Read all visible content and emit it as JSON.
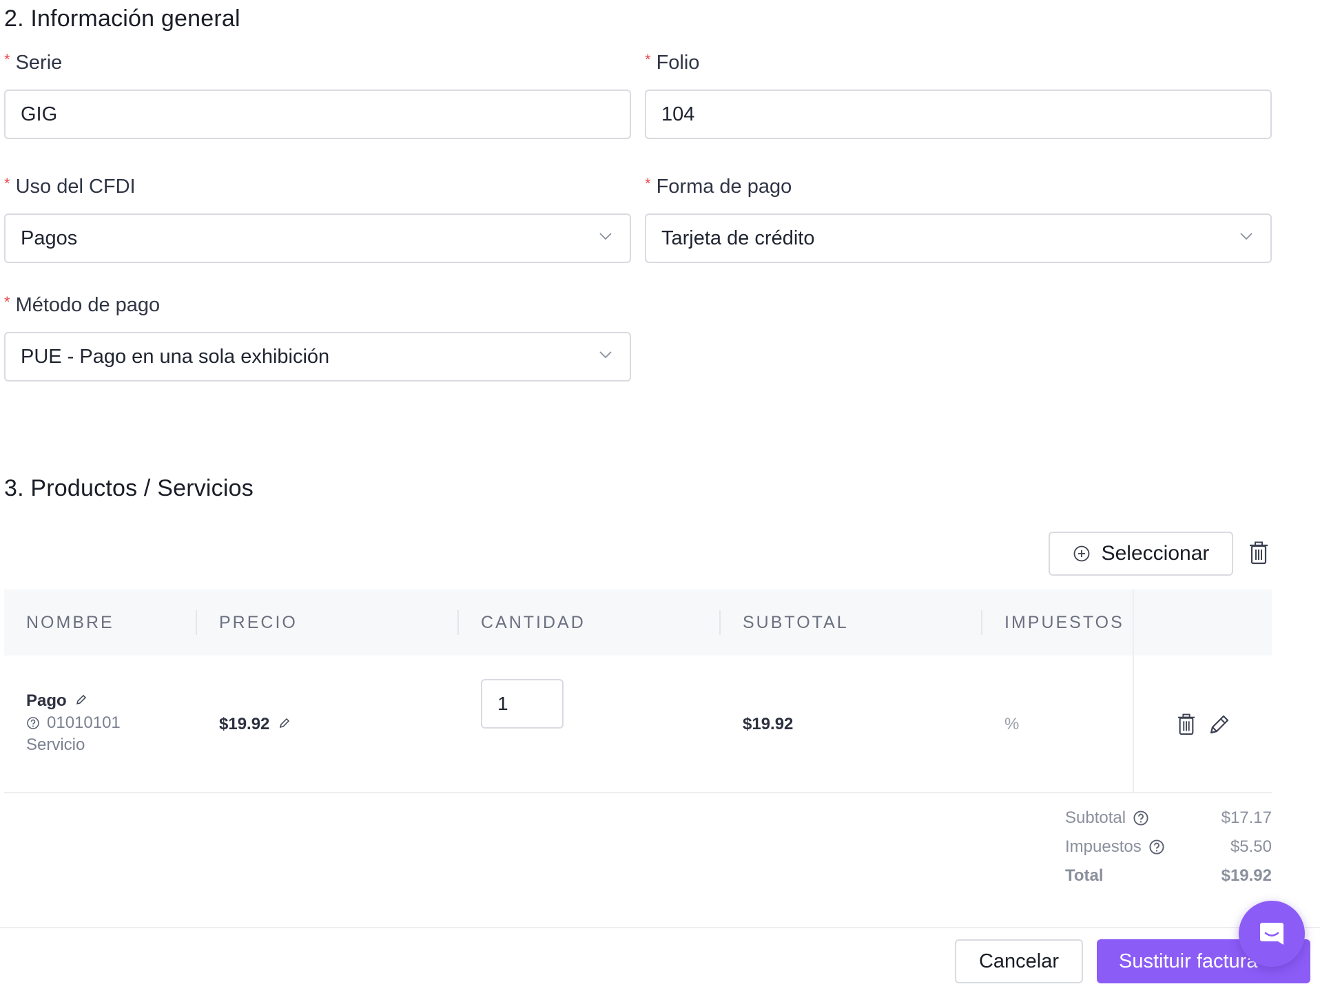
{
  "section2": {
    "title": "2. Información general",
    "fields": {
      "serie": {
        "label": "Serie",
        "value": "GIG"
      },
      "folio": {
        "label": "Folio",
        "value": "104"
      },
      "uso_cfdi": {
        "label": "Uso del CFDI",
        "value": "Pagos"
      },
      "forma_pago": {
        "label": "Forma de pago",
        "value": "Tarjeta de crédito"
      },
      "metodo_pago": {
        "label": "Método de pago",
        "value": "PUE - Pago en una sola exhibición"
      }
    },
    "required_marker": "*"
  },
  "section3": {
    "title": "3. Productos / Servicios",
    "select_button": "Seleccionar",
    "table": {
      "headers": [
        "NOMBRE",
        "PRECIO",
        "CANTIDAD",
        "SUBTOTAL",
        "IMPUESTOS"
      ],
      "rows": [
        {
          "name": "Pago",
          "code": "01010101",
          "type": "Servicio",
          "price": "$19.92",
          "quantity": "1",
          "subtotal": "$19.92",
          "taxes": "%"
        }
      ]
    },
    "summary": {
      "subtotal_label": "Subtotal",
      "subtotal_value": "$17.17",
      "taxes_label": "Impuestos",
      "taxes_value": "$5.50",
      "total_label": "Total",
      "total_value": "$19.92"
    }
  },
  "footer": {
    "cancel": "Cancelar",
    "submit": "Sustituir factura"
  },
  "colors": {
    "primary": "#8b5cf6",
    "required": "#e5484d",
    "border": "#d9dbe1",
    "muted_text": "#8a8f9c"
  },
  "icons": {
    "chevron": "chevron-down-icon",
    "trash": "trash-icon",
    "edit": "pencil-icon",
    "add": "plus-circle-icon",
    "help": "question-circle-icon",
    "chat": "chat-icon"
  }
}
